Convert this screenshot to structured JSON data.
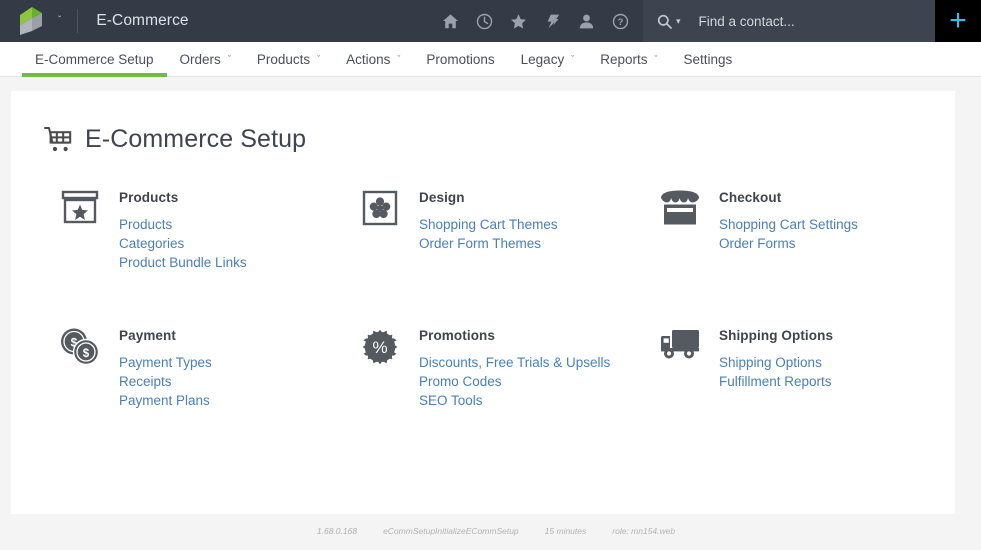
{
  "topbar": {
    "logo_name": "keap-logo",
    "app_dropdown_caret": "ˇ",
    "title": "E-Commerce",
    "icons": [
      {
        "name": "home-icon",
        "label": "Home"
      },
      {
        "name": "clock-icon",
        "label": "Recent"
      },
      {
        "name": "star-icon",
        "label": "Favorites"
      },
      {
        "name": "lightning-icon",
        "label": "Quick Actions"
      },
      {
        "name": "person-icon",
        "label": "Account"
      },
      {
        "name": "help-icon",
        "label": "Help"
      }
    ],
    "search": {
      "placeholder": "Find a contact...",
      "value": "",
      "icon": "search-icon",
      "caret": "▾"
    },
    "add_button": {
      "label": "+",
      "name": "add-button"
    }
  },
  "nav": {
    "items": [
      {
        "label": "E-Commerce Setup",
        "has_caret": false,
        "active": true
      },
      {
        "label": "Orders",
        "has_caret": true,
        "active": false
      },
      {
        "label": "Products",
        "has_caret": true,
        "active": false
      },
      {
        "label": "Actions",
        "has_caret": true,
        "active": false
      },
      {
        "label": "Promotions",
        "has_caret": false,
        "active": false
      },
      {
        "label": "Legacy",
        "has_caret": true,
        "active": false
      },
      {
        "label": "Reports",
        "has_caret": true,
        "active": false
      },
      {
        "label": "Settings",
        "has_caret": false,
        "active": false
      }
    ],
    "caret_glyph": "ˇ",
    "active_underline_color": "#6cbd45"
  },
  "page": {
    "title": "E-Commerce Setup",
    "title_icon": "shopping-cart-icon"
  },
  "sections": [
    {
      "title": "Products",
      "icon": "product-box-star-icon",
      "links": [
        "Products",
        "Categories",
        "Product Bundle Links"
      ]
    },
    {
      "title": "Design",
      "icon": "design-palette-icon",
      "links": [
        "Shopping Cart Themes",
        "Order Form Themes"
      ]
    },
    {
      "title": "Checkout",
      "icon": "storefront-icon",
      "links": [
        "Shopping Cart Settings",
        "Order Forms"
      ]
    },
    {
      "title": "Payment",
      "icon": "coins-dollar-icon",
      "links": [
        "Payment Types",
        "Receipts",
        "Payment Plans"
      ]
    },
    {
      "title": "Promotions",
      "icon": "percent-badge-icon",
      "links": [
        "Discounts, Free Trials & Upsells",
        "Promo Codes",
        "SEO Tools"
      ]
    },
    {
      "title": "Shipping Options",
      "icon": "delivery-truck-icon",
      "links": [
        "Shipping Options",
        "Fulfillment Reports"
      ]
    }
  ],
  "footer": {
    "version": "1.68.0.168",
    "action": "eCommSetupInitializeECommSetup",
    "duration": "15 minutes",
    "role": "role: mn154.web"
  },
  "colors": {
    "topbar_bg": "#343a46",
    "search_bg": "#3e444f",
    "add_bg": "#000000",
    "add_fg": "#3dbce7",
    "accent_green": "#6cbd45",
    "link_blue": "#4a80b4",
    "page_bg": "#f4f4f4",
    "panel_bg": "#ffffff",
    "icon_gray": "#545a60"
  }
}
